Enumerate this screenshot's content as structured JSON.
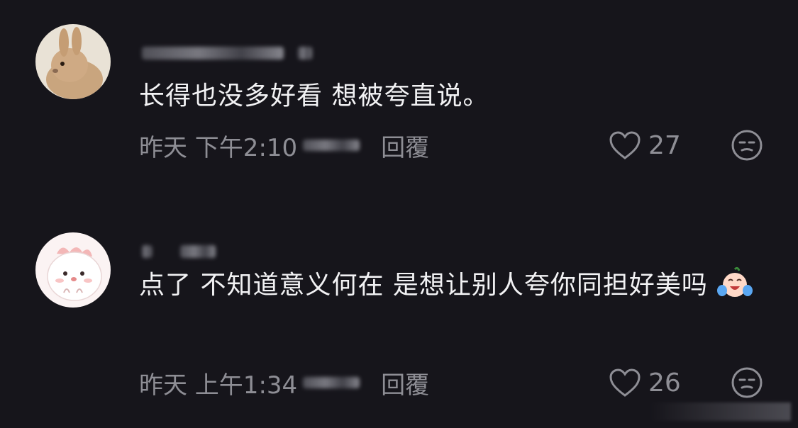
{
  "comments": [
    {
      "text": "长得也没多好看 想被夸直说。",
      "time": "昨天 下午2:10",
      "reply_label": "回覆",
      "likes": "27",
      "avatar": "rabbit-avatar"
    },
    {
      "text": "点了 不知道意义何在 是想让别人夸你同担好美吗",
      "emoji": "crying-laughing-emoji",
      "time": "昨天 上午1:34",
      "reply_label": "回覆",
      "likes": "26",
      "avatar": "cartoon-avatar"
    }
  ],
  "colors": {
    "background": "#16151b",
    "text": "#f2f2f4",
    "secondary": "#8e8e95"
  }
}
